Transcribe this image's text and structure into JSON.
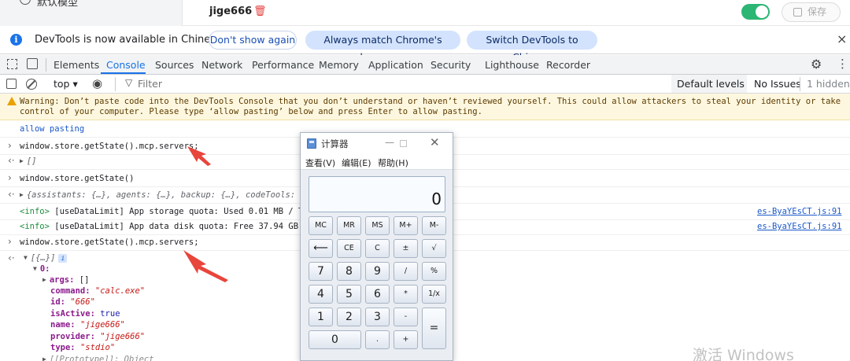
{
  "app": {
    "sidebar_label": "默认模型",
    "title": "jige666",
    "save_label": "保存",
    "toggle_on": true
  },
  "infobar": {
    "message": "DevTools is now available in Chinese",
    "dont_show": "Don't show again",
    "always_match": "Always match Chrome's language",
    "switch": "Switch DevTools to Chinese"
  },
  "tabs": [
    "Elements",
    "Console",
    "Sources",
    "Network",
    "Performance",
    "Memory",
    "Application",
    "Security",
    "Lighthouse",
    "Recorder"
  ],
  "active_tab": "Console",
  "console_toolbar": {
    "context": "top ▾",
    "filter_placeholder": "Filter",
    "levels": "Default levels ▾",
    "issues": "No Issues",
    "hidden": "1 hidden"
  },
  "console": {
    "warning": "Warning: Don’t paste code into the DevTools Console that you don’t understand or haven’t reviewed yourself. This could allow attackers to steal your identity or take control of your computer. Please type ‘allow pasting’ below and press Enter to allow pasting.",
    "allow_pasting": "allow pasting",
    "cmd1": "window.store.getState().mcp.servers;",
    "result1": "[]",
    "cmd2": "window.store.getState()",
    "result2": "{assistants: {…}, agents: {…}, backup: {…}, codeTools: {…}",
    "info1_tag": "<info>",
    "info1": "[useDataLimit] App storage quota: Used 0.01 MB / Tota",
    "info1_src": "es-ByaYEsCT.js:91",
    "info2_tag": "<info>",
    "info2": "[useDataLimit] App data disk quota: Free 37.94 GB",
    "info2_src": "es-ByaYEsCT.js:91",
    "cmd3": "window.store.getState().mcp.servers;",
    "result3": "[{…}]",
    "item_index": "0:",
    "fields": [
      {
        "key": "args:",
        "value": "[]",
        "kind": "plain",
        "expandable": true
      },
      {
        "key": "command:",
        "value": "\"calc.exe\"",
        "kind": "str",
        "expandable": false
      },
      {
        "key": "id:",
        "value": "\"666\"",
        "kind": "str",
        "expandable": false
      },
      {
        "key": "isActive:",
        "value": "true",
        "kind": "boo",
        "expandable": false
      },
      {
        "key": "name:",
        "value": "\"jige666\"",
        "kind": "str",
        "expandable": false
      },
      {
        "key": "provider:",
        "value": "\"jige666\"",
        "kind": "str",
        "expandable": false
      },
      {
        "key": "type:",
        "value": "\"stdio\"",
        "kind": "str",
        "expandable": false
      }
    ],
    "prototype": "[[Prototype]]: Object"
  },
  "calculator": {
    "title": "计算器",
    "menu": [
      "查看(V)",
      "编辑(E)",
      "帮助(H)"
    ],
    "display": "0",
    "keys": [
      [
        "MC",
        "MR",
        "MS",
        "M+",
        "M-"
      ],
      [
        "⟵",
        "CE",
        "C",
        "±",
        "√"
      ],
      [
        "7",
        "8",
        "9",
        "/",
        "%"
      ],
      [
        "4",
        "5",
        "6",
        "*",
        "1/x"
      ],
      [
        "1",
        "2",
        "3",
        "-",
        "="
      ],
      [
        "0",
        ".",
        "+"
      ]
    ]
  },
  "watermark": "激活 Windows"
}
